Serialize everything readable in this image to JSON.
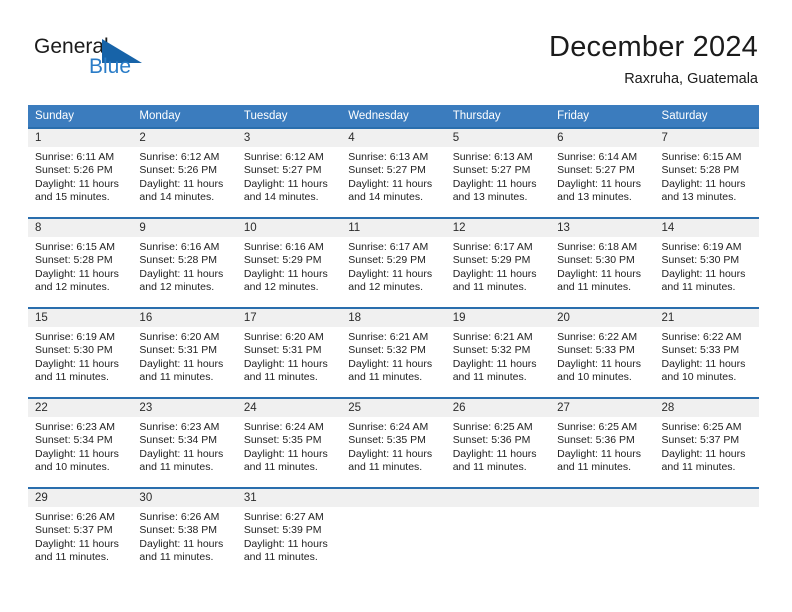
{
  "brand": {
    "name_top": "General",
    "name_bottom": "Blue",
    "triangle_icon": "blue-triangle-icon",
    "color_top": "#1b1b1b",
    "color_bottom": "#2a7cc7"
  },
  "header": {
    "title": "December 2024",
    "subtitle": "Raxruha, Guatemala"
  },
  "theme": {
    "header_blue": "#3b7cbe",
    "row_border_blue": "#2a6ead",
    "daynum_band": "#f0f0f0"
  },
  "calendar": {
    "weekday_headers": [
      "Sunday",
      "Monday",
      "Tuesday",
      "Wednesday",
      "Thursday",
      "Friday",
      "Saturday"
    ],
    "labels": {
      "sunrise": "Sunrise:",
      "sunset": "Sunset:",
      "daylight": "Daylight:"
    },
    "weeks": [
      [
        {
          "day": "1",
          "sunrise": "Sunrise: 6:11 AM",
          "sunset": "Sunset: 5:26 PM",
          "daylight_1": "Daylight: 11 hours",
          "daylight_2": "and 15 minutes."
        },
        {
          "day": "2",
          "sunrise": "Sunrise: 6:12 AM",
          "sunset": "Sunset: 5:26 PM",
          "daylight_1": "Daylight: 11 hours",
          "daylight_2": "and 14 minutes."
        },
        {
          "day": "3",
          "sunrise": "Sunrise: 6:12 AM",
          "sunset": "Sunset: 5:27 PM",
          "daylight_1": "Daylight: 11 hours",
          "daylight_2": "and 14 minutes."
        },
        {
          "day": "4",
          "sunrise": "Sunrise: 6:13 AM",
          "sunset": "Sunset: 5:27 PM",
          "daylight_1": "Daylight: 11 hours",
          "daylight_2": "and 14 minutes."
        },
        {
          "day": "5",
          "sunrise": "Sunrise: 6:13 AM",
          "sunset": "Sunset: 5:27 PM",
          "daylight_1": "Daylight: 11 hours",
          "daylight_2": "and 13 minutes."
        },
        {
          "day": "6",
          "sunrise": "Sunrise: 6:14 AM",
          "sunset": "Sunset: 5:27 PM",
          "daylight_1": "Daylight: 11 hours",
          "daylight_2": "and 13 minutes."
        },
        {
          "day": "7",
          "sunrise": "Sunrise: 6:15 AM",
          "sunset": "Sunset: 5:28 PM",
          "daylight_1": "Daylight: 11 hours",
          "daylight_2": "and 13 minutes."
        }
      ],
      [
        {
          "day": "8",
          "sunrise": "Sunrise: 6:15 AM",
          "sunset": "Sunset: 5:28 PM",
          "daylight_1": "Daylight: 11 hours",
          "daylight_2": "and 12 minutes."
        },
        {
          "day": "9",
          "sunrise": "Sunrise: 6:16 AM",
          "sunset": "Sunset: 5:28 PM",
          "daylight_1": "Daylight: 11 hours",
          "daylight_2": "and 12 minutes."
        },
        {
          "day": "10",
          "sunrise": "Sunrise: 6:16 AM",
          "sunset": "Sunset: 5:29 PM",
          "daylight_1": "Daylight: 11 hours",
          "daylight_2": "and 12 minutes."
        },
        {
          "day": "11",
          "sunrise": "Sunrise: 6:17 AM",
          "sunset": "Sunset: 5:29 PM",
          "daylight_1": "Daylight: 11 hours",
          "daylight_2": "and 12 minutes."
        },
        {
          "day": "12",
          "sunrise": "Sunrise: 6:17 AM",
          "sunset": "Sunset: 5:29 PM",
          "daylight_1": "Daylight: 11 hours",
          "daylight_2": "and 11 minutes."
        },
        {
          "day": "13",
          "sunrise": "Sunrise: 6:18 AM",
          "sunset": "Sunset: 5:30 PM",
          "daylight_1": "Daylight: 11 hours",
          "daylight_2": "and 11 minutes."
        },
        {
          "day": "14",
          "sunrise": "Sunrise: 6:19 AM",
          "sunset": "Sunset: 5:30 PM",
          "daylight_1": "Daylight: 11 hours",
          "daylight_2": "and 11 minutes."
        }
      ],
      [
        {
          "day": "15",
          "sunrise": "Sunrise: 6:19 AM",
          "sunset": "Sunset: 5:30 PM",
          "daylight_1": "Daylight: 11 hours",
          "daylight_2": "and 11 minutes."
        },
        {
          "day": "16",
          "sunrise": "Sunrise: 6:20 AM",
          "sunset": "Sunset: 5:31 PM",
          "daylight_1": "Daylight: 11 hours",
          "daylight_2": "and 11 minutes."
        },
        {
          "day": "17",
          "sunrise": "Sunrise: 6:20 AM",
          "sunset": "Sunset: 5:31 PM",
          "daylight_1": "Daylight: 11 hours",
          "daylight_2": "and 11 minutes."
        },
        {
          "day": "18",
          "sunrise": "Sunrise: 6:21 AM",
          "sunset": "Sunset: 5:32 PM",
          "daylight_1": "Daylight: 11 hours",
          "daylight_2": "and 11 minutes."
        },
        {
          "day": "19",
          "sunrise": "Sunrise: 6:21 AM",
          "sunset": "Sunset: 5:32 PM",
          "daylight_1": "Daylight: 11 hours",
          "daylight_2": "and 11 minutes."
        },
        {
          "day": "20",
          "sunrise": "Sunrise: 6:22 AM",
          "sunset": "Sunset: 5:33 PM",
          "daylight_1": "Daylight: 11 hours",
          "daylight_2": "and 10 minutes."
        },
        {
          "day": "21",
          "sunrise": "Sunrise: 6:22 AM",
          "sunset": "Sunset: 5:33 PM",
          "daylight_1": "Daylight: 11 hours",
          "daylight_2": "and 10 minutes."
        }
      ],
      [
        {
          "day": "22",
          "sunrise": "Sunrise: 6:23 AM",
          "sunset": "Sunset: 5:34 PM",
          "daylight_1": "Daylight: 11 hours",
          "daylight_2": "and 10 minutes."
        },
        {
          "day": "23",
          "sunrise": "Sunrise: 6:23 AM",
          "sunset": "Sunset: 5:34 PM",
          "daylight_1": "Daylight: 11 hours",
          "daylight_2": "and 11 minutes."
        },
        {
          "day": "24",
          "sunrise": "Sunrise: 6:24 AM",
          "sunset": "Sunset: 5:35 PM",
          "daylight_1": "Daylight: 11 hours",
          "daylight_2": "and 11 minutes."
        },
        {
          "day": "25",
          "sunrise": "Sunrise: 6:24 AM",
          "sunset": "Sunset: 5:35 PM",
          "daylight_1": "Daylight: 11 hours",
          "daylight_2": "and 11 minutes."
        },
        {
          "day": "26",
          "sunrise": "Sunrise: 6:25 AM",
          "sunset": "Sunset: 5:36 PM",
          "daylight_1": "Daylight: 11 hours",
          "daylight_2": "and 11 minutes."
        },
        {
          "day": "27",
          "sunrise": "Sunrise: 6:25 AM",
          "sunset": "Sunset: 5:36 PM",
          "daylight_1": "Daylight: 11 hours",
          "daylight_2": "and 11 minutes."
        },
        {
          "day": "28",
          "sunrise": "Sunrise: 6:25 AM",
          "sunset": "Sunset: 5:37 PM",
          "daylight_1": "Daylight: 11 hours",
          "daylight_2": "and 11 minutes."
        }
      ],
      [
        {
          "day": "29",
          "sunrise": "Sunrise: 6:26 AM",
          "sunset": "Sunset: 5:37 PM",
          "daylight_1": "Daylight: 11 hours",
          "daylight_2": "and 11 minutes."
        },
        {
          "day": "30",
          "sunrise": "Sunrise: 6:26 AM",
          "sunset": "Sunset: 5:38 PM",
          "daylight_1": "Daylight: 11 hours",
          "daylight_2": "and 11 minutes."
        },
        {
          "day": "31",
          "sunrise": "Sunrise: 6:27 AM",
          "sunset": "Sunset: 5:39 PM",
          "daylight_1": "Daylight: 11 hours",
          "daylight_2": "and 11 minutes."
        },
        {
          "day": "",
          "sunrise": "",
          "sunset": "",
          "daylight_1": "",
          "daylight_2": ""
        },
        {
          "day": "",
          "sunrise": "",
          "sunset": "",
          "daylight_1": "",
          "daylight_2": ""
        },
        {
          "day": "",
          "sunrise": "",
          "sunset": "",
          "daylight_1": "",
          "daylight_2": ""
        },
        {
          "day": "",
          "sunrise": "",
          "sunset": "",
          "daylight_1": "",
          "daylight_2": ""
        }
      ]
    ]
  }
}
